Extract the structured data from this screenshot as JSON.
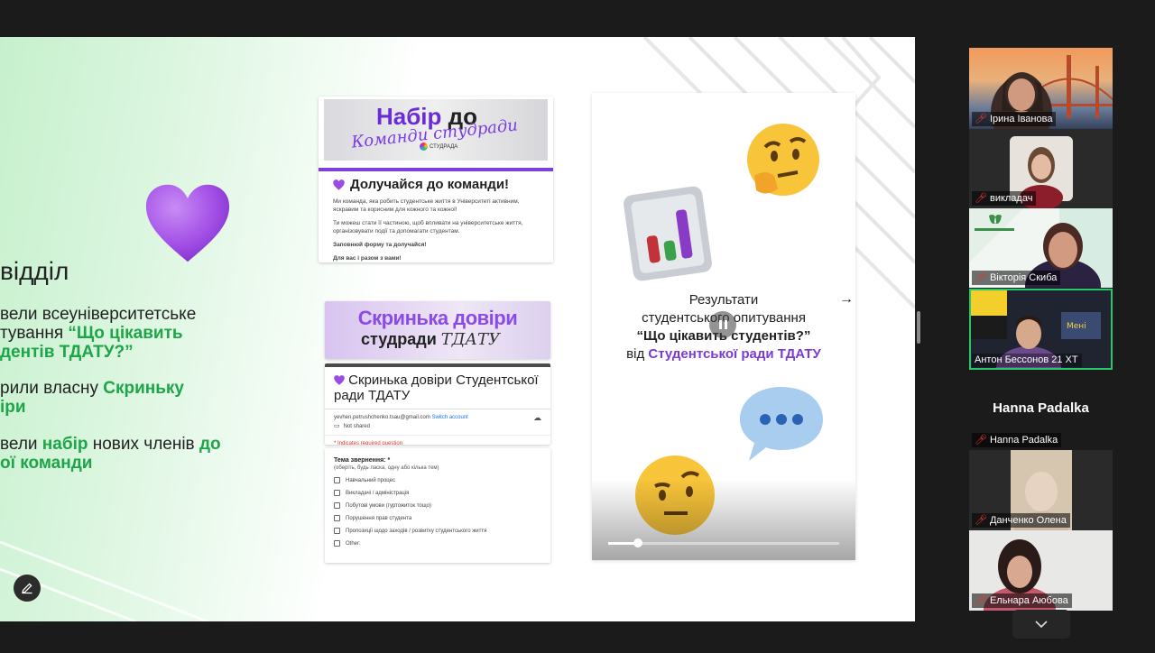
{
  "slide": {
    "section_title": "відділ",
    "bullets": [
      {
        "line1": "вели всеуніверситетське",
        "line2_plain": "тування ",
        "line2_green": "“Що цікавить",
        "line3_green": "дентів ТДАТУ?”"
      },
      {
        "line1_plain": "рили власну ",
        "line1_green": "Скриньку",
        "line2_green": "іри"
      },
      {
        "line1_plain": "вели ",
        "line1_green": "набір",
        "line1_plain2": " нових членів ",
        "line1_green2": "до",
        "line2_green": "ої команди"
      }
    ]
  },
  "card1": {
    "banner_title": "Набір",
    "banner_title_rest": " до",
    "banner_script": "Команди студради",
    "logo": "СТУДРАДА",
    "heading": "Долучайся до команди!",
    "p1": "Ми команда, яка робить студентське життя в Університеті активним, яскравим та корисним для кожного та кожної!",
    "p2": "Ти можеш стати її частиною, щоб впливати на університетське життя, організовувати події та допомагати студентам.",
    "p3": "Заповнюй форму та долучайся!",
    "p4": "Для вас і разом з вами!"
  },
  "card2": {
    "banner_title": "Скринька довіри",
    "banner_sub": "студради",
    "banner_script": "ТДАТУ"
  },
  "card3": {
    "heading": "Скринька довіри Студентської ради ТДАТУ",
    "email": "yevhen.petrushchenko.tsau@gmail.com",
    "switch": "Switch account",
    "not_shared": "Not shared",
    "required": "* Indicates required question"
  },
  "card4": {
    "question": "Тема звернення: *",
    "hint": "(оберіть, будь ласка, одну або кілька тем)",
    "options": [
      "Навчальний процес",
      "Викладачі / адміністрація",
      "Побутові умови (гуртожиток тощо)",
      "Порушення прав студента",
      "Пропозиції щодо заходів / розвитку студентського життя",
      "Other:"
    ]
  },
  "video": {
    "line1": "Результати",
    "line2": "студентського опитування",
    "line3": "“Що цікавить студентів?”",
    "line4_plain": "від ",
    "line4_purple": "Студентської ради ТДАТУ",
    "progress": 0.13
  },
  "participants": [
    {
      "name": "Ірина Іванова",
      "muted": true
    },
    {
      "name": "викладач",
      "muted": true
    },
    {
      "name": "Вікторія Скиба",
      "muted": true
    },
    {
      "name": "Антон Бессонов 21 ХТ",
      "muted": false,
      "active": true
    },
    {
      "name": "Hanna Padalka",
      "muted": true,
      "title": "Hanna Padalka"
    },
    {
      "name": "Данченко Олена",
      "muted": true
    },
    {
      "name": "Ельнара Аюбова",
      "muted": true
    }
  ],
  "colors": {
    "accent_green": "#1ea548",
    "accent_purple": "#7c3ad6",
    "active_border": "#27c76a",
    "muted_mic": "#e5362d"
  }
}
